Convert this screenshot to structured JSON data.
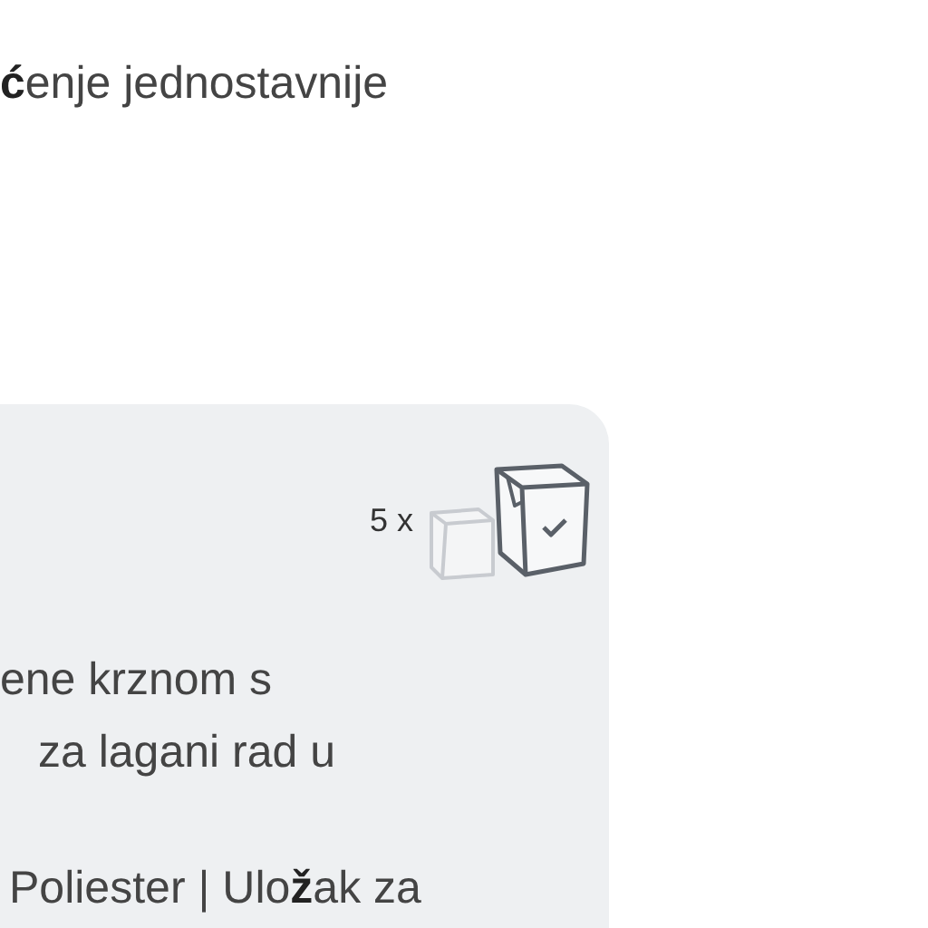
{
  "heading": "**ć**enje jednostavnije",
  "card": {
    "quantity": "5 x",
    "lines": [
      "ene krznom s",
      "za lagani rad u",
      "Poliester | Ulo**ž**ak za"
    ]
  }
}
